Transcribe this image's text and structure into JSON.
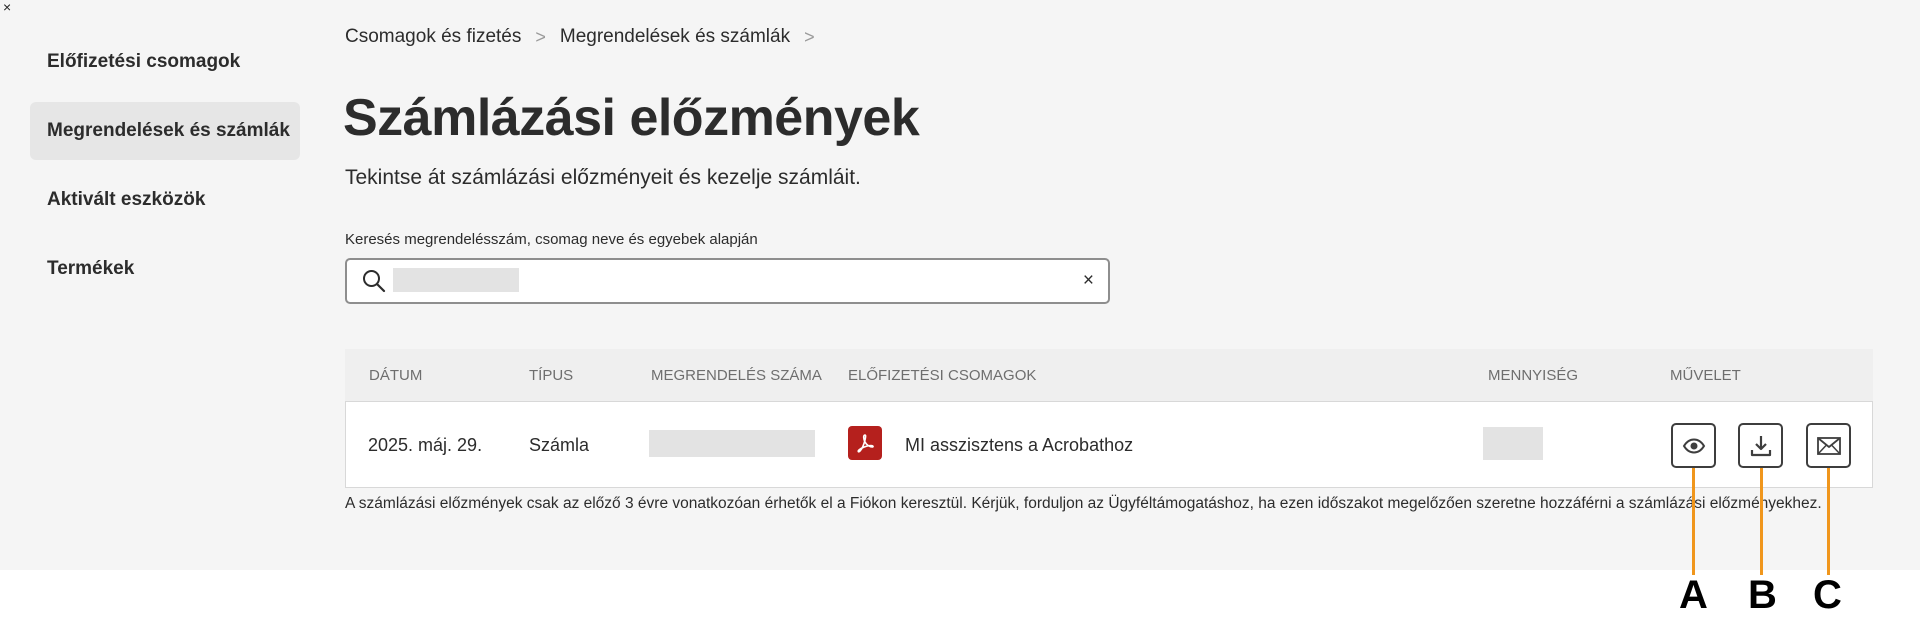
{
  "window": {
    "close_glyph": "×"
  },
  "sidebar": {
    "items": [
      {
        "label": "Előfizetési csomagok",
        "active": false
      },
      {
        "label": "Megrendelések és számlák",
        "active": true
      },
      {
        "label": "Aktivált eszközök",
        "active": false
      },
      {
        "label": "Termékek",
        "active": false
      }
    ]
  },
  "breadcrumb": {
    "items": [
      "Csomagok és fizetés",
      "Megrendelések és számlák"
    ],
    "separator": ">"
  },
  "main": {
    "title": "Számlázási előzmények",
    "subtitle": "Tekintse át számlázási előzményeit és kezelje számláit.",
    "search": {
      "label": "Keresés megrendelésszám, csomag neve és egyebek alapján",
      "value": "",
      "placeholder": "",
      "clear_glyph": "×"
    },
    "table": {
      "headers": {
        "date": "DÁTUM",
        "type": "TÍPUS",
        "order": "MEGRENDELÉS SZÁMA",
        "plans": "ELŐFIZETÉSI CSOMAGOK",
        "quantity": "MENNYISÉG",
        "action": "MŰVELET"
      },
      "rows": [
        {
          "date": "2025. máj. 29.",
          "type": "Számla",
          "order_number": "",
          "product_icon": "acrobat-pdf-icon",
          "product": "MI asszisztens a Acrobathoz",
          "quantity": ""
        }
      ]
    },
    "footnote": "A számlázási előzmények csak az előző 3 évre vonatkozóan érhetők el a Fiókon keresztül. Kérjük, forduljon az Ügyféltámogatáshoz, ha ezen időszakot megelőzően szeretne hozzáférni a számlázási előzményekhez."
  },
  "actions": [
    {
      "icon": "eye-icon",
      "callout": "A"
    },
    {
      "icon": "download-icon",
      "callout": "B"
    },
    {
      "icon": "envelope-icon",
      "callout": "C"
    }
  ],
  "colors": {
    "background": "#f5f5f5",
    "acrobat_red": "#b5201d",
    "callout_orange": "#f0961c"
  }
}
